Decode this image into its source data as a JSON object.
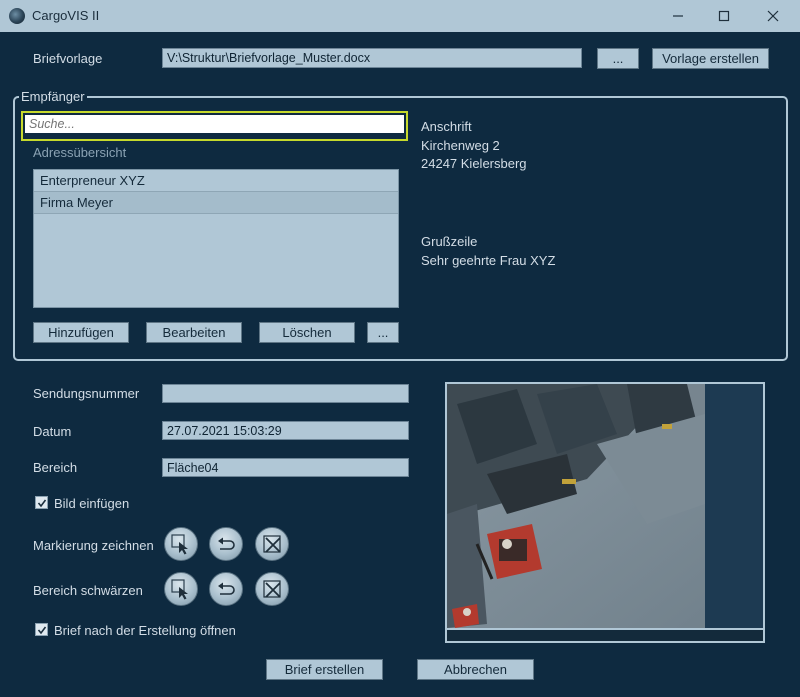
{
  "window": {
    "title": "CargoVIS II"
  },
  "template": {
    "label": "Briefvorlage",
    "path": "V:\\Struktur\\Briefvorlage_Muster.docx",
    "browse_label": "...",
    "create_label": "Vorlage erstellen"
  },
  "recipient": {
    "group_label": "Empfänger",
    "search_placeholder": "Suche...",
    "overview_label": "Adressübersicht",
    "addresses": [
      "Enterpreneur XYZ",
      "Firma Meyer"
    ],
    "selected_index": 1,
    "add_label": "Hinzufügen",
    "edit_label": "Bearbeiten",
    "delete_label": "Löschen",
    "more_label": "...",
    "address_heading": "Anschrift",
    "street": "Kirchenweg 2",
    "city": "24247 Kielersberg",
    "greeting_heading": "Grußzeile",
    "greeting": "Sehr geehrte Frau  XYZ"
  },
  "form": {
    "shipment_label": "Sendungsnummer",
    "shipment_value": "",
    "date_label": "Datum",
    "date_value": "27.07.2021 15:03:29",
    "area_label": "Bereich",
    "area_value": "Fläche04",
    "insert_image_label": "Bild einfügen",
    "insert_image_checked": true,
    "draw_marking_label": "Markierung zeichnen",
    "blacken_area_label": "Bereich schwärzen",
    "open_after_label": "Brief nach der Erstellung öffnen",
    "open_after_checked": true
  },
  "icons": {
    "select": "cursor-select-icon",
    "undo": "undo-arrow-icon",
    "clear": "clear-cross-icon"
  },
  "footer": {
    "create_letter_label": "Brief erstellen",
    "cancel_label": "Abbrechen"
  },
  "colors": {
    "background": "#0e2a40",
    "panel": "#b0c7d6",
    "search_highlight": "#c6d92c",
    "text": "#d3dde6"
  }
}
